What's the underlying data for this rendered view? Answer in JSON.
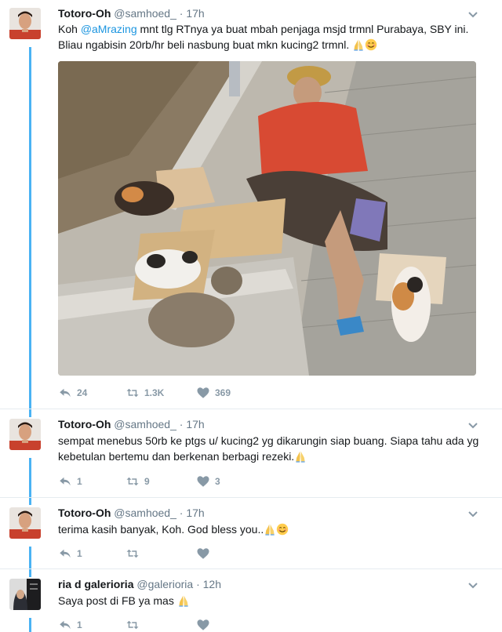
{
  "tweets": [
    {
      "name": "Totoro-Oh",
      "handle": "@samhoed_",
      "time": "17h",
      "text_prefix": "Koh ",
      "mention": "@aMrazing",
      "text_suffix": " mnt tlg RTnya ya buat mbah penjaga msjd trmnl Purabaya, SBY ini. Bliau ngabisin 20rb/hr beli nasbung buat mkn kucing2 trmnl.",
      "emojis": [
        "folded-hands",
        "smiling-face"
      ],
      "replies": "24",
      "retweets": "1.3K",
      "likes": "369"
    },
    {
      "name": "Totoro-Oh",
      "handle": "@samhoed_",
      "time": "17h",
      "text": "sempat menebus 50rb ke ptgs u/ kucing2 yg dikarungin siap buang. Siapa tahu ada yg kebetulan bertemu dan berkenan berbagi rezeki.",
      "emojis": [
        "folded-hands"
      ],
      "replies": "1",
      "retweets": "9",
      "likes": "3"
    },
    {
      "name": "Totoro-Oh",
      "handle": "@samhoed_",
      "time": "17h",
      "text": "terima kasih banyak, Koh. God bless you..",
      "emojis": [
        "folded-hands",
        "smiling-face"
      ],
      "replies": "1",
      "retweets": "",
      "likes": ""
    },
    {
      "name": "ria d galerioria",
      "handle": "@galerioria",
      "time": "12h",
      "text": "Saya post di FB ya mas",
      "emojis": [
        "folded-hands"
      ],
      "replies": "1",
      "retweets": "",
      "likes": ""
    }
  ],
  "separator": "·",
  "colors": {
    "link": "#1b95e0",
    "thread": "#4ab3f4",
    "muted": "#657786",
    "icon": "#8899a6"
  }
}
